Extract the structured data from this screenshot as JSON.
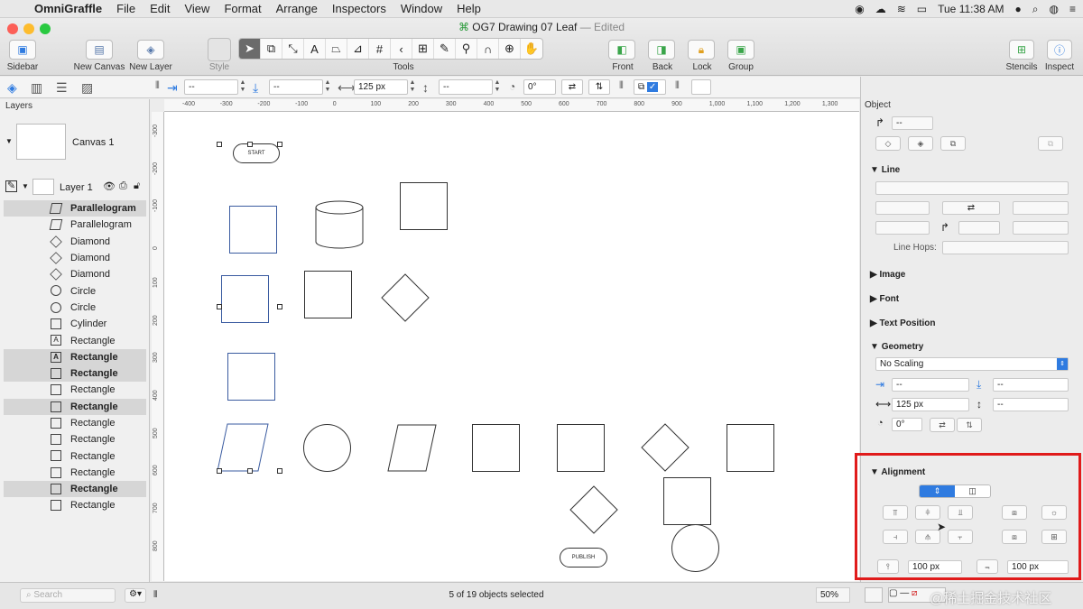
{
  "menubar": {
    "app": "OmniGraffle",
    "items": [
      "File",
      "Edit",
      "View",
      "Format",
      "Arrange",
      "Inspectors",
      "Window",
      "Help"
    ],
    "clock": "Tue 11:38 AM"
  },
  "window": {
    "title": "OG7 Drawing 07 Leaf",
    "edited": "— Edited"
  },
  "toolbar": {
    "sidebar": "Sidebar",
    "new_canvas": "New Canvas",
    "new_layer": "New Layer",
    "style": "Style",
    "tools": "Tools",
    "front": "Front",
    "back": "Back",
    "lock": "Lock",
    "group": "Group",
    "stencils": "Stencils",
    "inspect": "Inspect"
  },
  "format_bar": {
    "x_value": "--",
    "y_value": "--",
    "width_value": "125 px",
    "height_value": "--",
    "rotation_value": "0°"
  },
  "sidebar": {
    "header": "Layers",
    "canvas_name": "Canvas 1",
    "layer_name": "Layer 1",
    "objects": [
      {
        "label": "Parallelogram",
        "icon": "P",
        "selected": true
      },
      {
        "label": "Parallelogram",
        "icon": "P",
        "selected": false
      },
      {
        "label": "Diamond",
        "icon": "◇",
        "selected": false
      },
      {
        "label": "Diamond",
        "icon": "◇",
        "selected": false
      },
      {
        "label": "Diamond",
        "icon": "◇",
        "selected": false
      },
      {
        "label": "Circle",
        "icon": "○",
        "selected": false
      },
      {
        "label": "Circle",
        "icon": "○",
        "selected": false
      },
      {
        "label": "Cylinder",
        "icon": "C",
        "selected": false
      },
      {
        "label": "Rectangle",
        "icon": "A",
        "selected": false
      },
      {
        "label": "Rectangle",
        "icon": "A",
        "selected": true
      },
      {
        "label": "Rectangle",
        "icon": "",
        "selected": true
      },
      {
        "label": "Rectangle",
        "icon": "",
        "selected": false
      },
      {
        "label": "Rectangle",
        "icon": "",
        "selected": true
      },
      {
        "label": "Rectangle",
        "icon": "",
        "selected": false
      },
      {
        "label": "Rectangle",
        "icon": "",
        "selected": false
      },
      {
        "label": "Rectangle",
        "icon": "",
        "selected": false
      },
      {
        "label": "Rectangle",
        "icon": "",
        "selected": false
      },
      {
        "label": "Rectangle",
        "icon": "",
        "selected": true
      },
      {
        "label": "Rectangle",
        "icon": "",
        "selected": false
      }
    ]
  },
  "rulers": {
    "h": [
      "-400",
      "-300",
      "-200",
      "-100",
      "0",
      "100",
      "200",
      "300",
      "400",
      "500",
      "600",
      "700",
      "800",
      "900",
      "1,000",
      "1,100",
      "1,200",
      "1,300"
    ],
    "v": [
      "-300",
      "-200",
      "-100",
      "0",
      "100",
      "200",
      "300",
      "400",
      "500",
      "600",
      "700",
      "800"
    ]
  },
  "canvas": {
    "start_label": "START",
    "publish_label": "PUBLISH"
  },
  "inspector": {
    "object_header": "Object",
    "line_field": "--",
    "line_section": "Line",
    "line_hops": "Line Hops:",
    "image_section": "Image",
    "font_section": "Font",
    "text_position_section": "Text Position",
    "geometry_section": "Geometry",
    "scaling": "No Scaling",
    "geo_x": "--",
    "geo_y": "--",
    "geo_width": "125 px",
    "geo_height": "--",
    "geo_rotation": "0°",
    "alignment_section": "Alignment",
    "spacing_h": "100 px",
    "spacing_v": "100 px"
  },
  "status": {
    "search_placeholder": "Search",
    "selection": "5 of 19 objects selected",
    "zoom": "50%",
    "watermark": "@稀土掘金技术社区"
  },
  "colors": {
    "accent": "#2f7be0",
    "highlight_box": "#e01b1b"
  }
}
